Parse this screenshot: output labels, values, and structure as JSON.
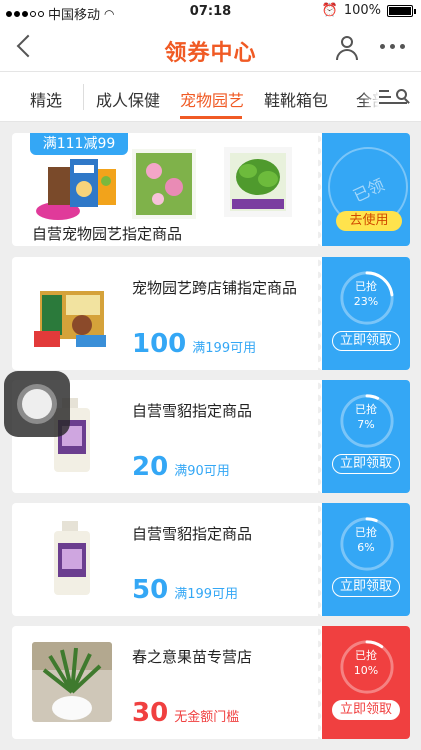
{
  "status_bar": {
    "carrier": "中国移动",
    "time": "07:18",
    "battery": "100%"
  },
  "nav": {
    "title": "领券中心"
  },
  "tabs": [
    "精选",
    "成人保健",
    "宠物园艺",
    "鞋靴箱包",
    "全部"
  ],
  "active_tab": "宠物园艺",
  "colors": {
    "accent": "#f05a24",
    "coupon_blue": "#34a7f5",
    "coupon_red": "#f04040"
  },
  "coupons": [
    {
      "badge": "满111减99",
      "store": "自营宠物园艺指定商品",
      "action": "去使用",
      "stamp": "已领"
    },
    {
      "name": "宠物园艺跨店铺指定商品",
      "amount": "100",
      "condition": "满199可用",
      "status": "已抢",
      "percent_label": "23%",
      "percent": 23,
      "action": "立即领取",
      "color": "blue"
    },
    {
      "name": "自营雪貂指定商品",
      "amount": "20",
      "condition": "满90可用",
      "status": "已抢",
      "percent_label": "7%",
      "percent": 7,
      "action": "立即领取",
      "color": "blue"
    },
    {
      "name": "自营雪貂指定商品",
      "amount": "50",
      "condition": "满199可用",
      "status": "已抢",
      "percent_label": "6%",
      "percent": 6,
      "action": "立即领取",
      "color": "blue"
    },
    {
      "name": "春之意果苗专营店",
      "amount": "30",
      "condition": "无金额门槛",
      "status": "已抢",
      "percent_label": "10%",
      "percent": 10,
      "action": "立即领取",
      "color": "red"
    }
  ]
}
